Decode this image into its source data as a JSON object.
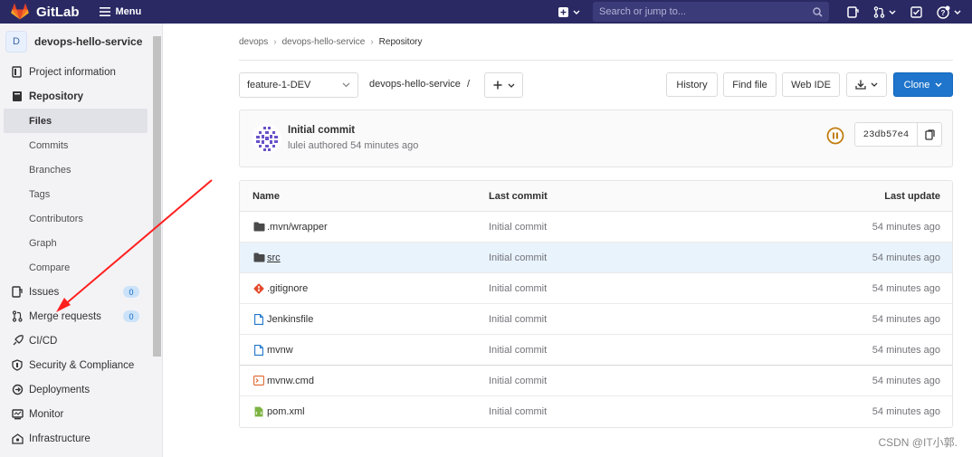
{
  "topbar": {
    "brand": "GitLab",
    "menu_label": "Menu",
    "search_placeholder": "Search or jump to..."
  },
  "sidebar": {
    "project_initial": "D",
    "project_name": "devops-hello-service",
    "items": [
      {
        "label": "Project information",
        "icon": "info-icon"
      },
      {
        "label": "Repository",
        "icon": "book-icon"
      },
      {
        "label": "Issues",
        "icon": "issues-icon",
        "badge": "0"
      },
      {
        "label": "Merge requests",
        "icon": "merge-request-icon",
        "badge": "0"
      },
      {
        "label": "CI/CD",
        "icon": "rocket-icon"
      },
      {
        "label": "Security & Compliance",
        "icon": "shield-icon"
      },
      {
        "label": "Deployments",
        "icon": "deployments-icon"
      },
      {
        "label": "Monitor",
        "icon": "monitor-icon"
      },
      {
        "label": "Infrastructure",
        "icon": "cloud-icon"
      }
    ],
    "repository_sub": [
      "Files",
      "Commits",
      "Branches",
      "Tags",
      "Contributors",
      "Graph",
      "Compare"
    ]
  },
  "breadcrumb": [
    "devops",
    "devops-hello-service",
    "Repository"
  ],
  "toolbar": {
    "branch": "feature-1-DEV",
    "path": "devops-hello-service",
    "path_sep": "/",
    "history": "History",
    "find_file": "Find file",
    "web_ide": "Web IDE",
    "clone": "Clone"
  },
  "commit": {
    "title": "Initial commit",
    "meta": "lulei authored 54 minutes ago",
    "sha": "23db57e4",
    "pipeline_color": "#c17d10"
  },
  "table": {
    "headers": {
      "name": "Name",
      "last_commit": "Last commit",
      "last_update": "Last update"
    },
    "rows": [
      {
        "name": ".mvn/wrapper",
        "type": "folder",
        "commit": "Initial commit",
        "date": "54 minutes ago"
      },
      {
        "name": "src",
        "type": "folder",
        "commit": "Initial commit",
        "date": "54 minutes ago"
      },
      {
        "name": ".gitignore",
        "type": "git",
        "commit": "Initial commit",
        "date": "54 minutes ago"
      },
      {
        "name": "Jenkinsfile",
        "type": "file",
        "commit": "Initial commit",
        "date": "54 minutes ago"
      },
      {
        "name": "mvnw",
        "type": "file",
        "commit": "Initial commit",
        "date": "54 minutes ago"
      },
      {
        "name": "mvnw.cmd",
        "type": "terminal",
        "commit": "Initial commit",
        "date": "54 minutes ago"
      },
      {
        "name": "pom.xml",
        "type": "xml",
        "commit": "Initial commit",
        "date": "54 minutes ago"
      }
    ]
  },
  "watermark": "CSDN @IT小郭."
}
